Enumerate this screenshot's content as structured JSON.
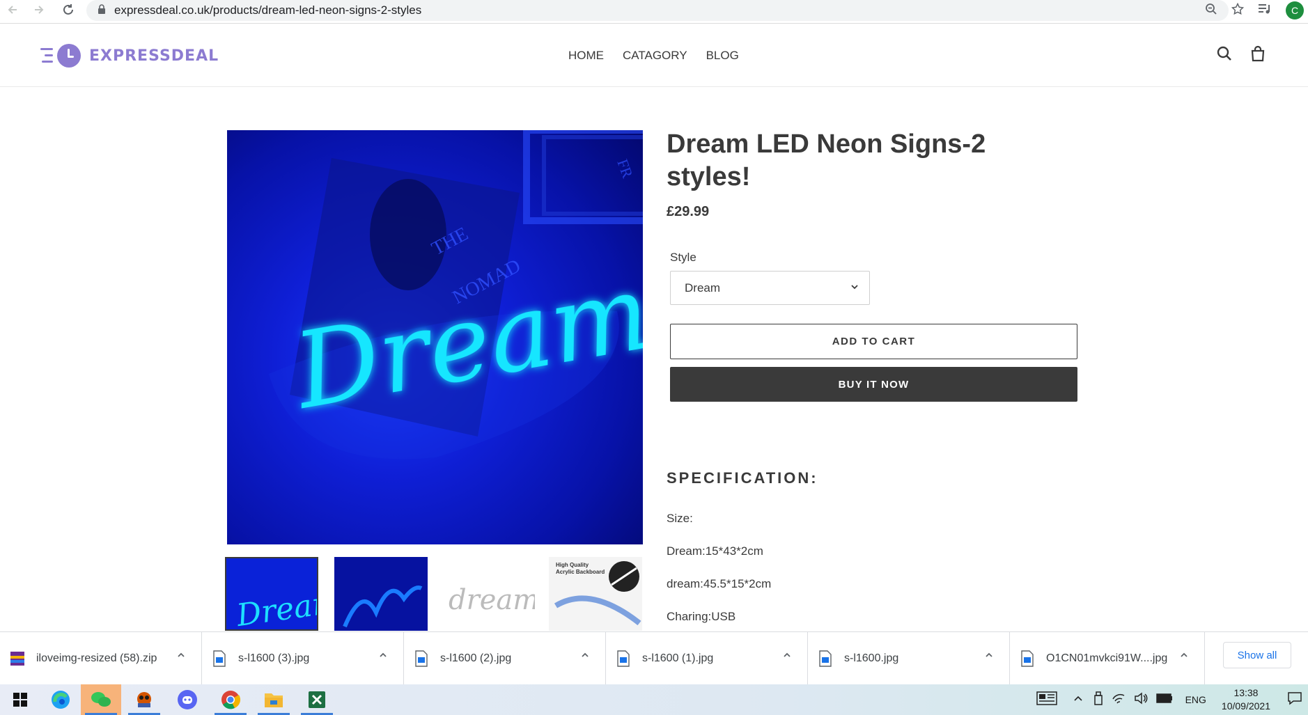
{
  "browser": {
    "url": "expressdeal.co.uk/products/dream-led-neon-signs-2-styles",
    "avatar_letter": "C"
  },
  "site": {
    "logo_text": "EXPRESSDEAL",
    "brand_color": "#8c7bd1",
    "nav": [
      "HOME",
      "CATAGORY",
      "BLOG"
    ]
  },
  "product": {
    "title": "Dream LED Neon Signs-2 styles!",
    "price": "£29.99",
    "style_label": "Style",
    "style_selected": "Dream",
    "add_to_cart": "ADD TO CART",
    "buy_now": "BUY IT NOW",
    "spec_heading": "SPECIFICATION:",
    "spec_lines": [
      "Size:",
      "Dream:15*43*2cm",
      "dream:45.5*15*2cm",
      "Charing:USB"
    ],
    "image_text": {
      "main_sign": "Dream",
      "book_line1": "THE",
      "book_line2": "NOMAD",
      "frame_letters": "FR",
      "thumb3_sign": "dream",
      "thumb4_caption_line1": "High Quality",
      "thumb4_caption_line2": "Acrylic Backboard"
    }
  },
  "downloads": {
    "items": [
      {
        "name": "iloveimg-resized (58).zip",
        "icon": "zip-icon"
      },
      {
        "name": "s-l1600 (3).jpg",
        "icon": "image-file-icon"
      },
      {
        "name": "s-l1600 (2).jpg",
        "icon": "image-file-icon"
      },
      {
        "name": "s-l1600 (1).jpg",
        "icon": "image-file-icon"
      },
      {
        "name": "s-l1600.jpg",
        "icon": "image-file-icon"
      },
      {
        "name": "O1CN01mvkci91W....jpg",
        "icon": "image-file-icon"
      }
    ],
    "show_all": "Show all"
  },
  "taskbar": {
    "lang": "ENG",
    "time": "13:38",
    "date": "10/09/2021"
  }
}
